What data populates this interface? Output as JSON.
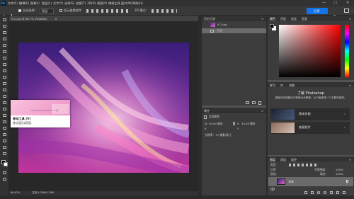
{
  "app": {
    "logo": "Ps",
    "menus": [
      "文件(F)",
      "编辑(E)",
      "图像(I)",
      "图层(L)",
      "文字(Y)",
      "选择(S)",
      "滤镜(T)",
      "3D(D)",
      "视图(V)",
      "增效工具",
      "窗口(W)",
      "帮助(H)"
    ],
    "window_controls": [
      "—",
      "□",
      "✕"
    ]
  },
  "options_bar": {
    "auto_select_label": "自动选择：",
    "auto_select_value": "图层",
    "transform_label": "显示变换控件",
    "mode_3d_label": "3D 模式：",
    "share_button": "分享"
  },
  "document": {
    "tab_title": "9-1.jpg @ 66.7% (RGB/8#)",
    "zoom": "66.67%",
    "doc_info": "文档:4.29M/4.29M"
  },
  "tooltip": {
    "title": "移动工具 (V)",
    "description": "移动选区或图层"
  },
  "history_panel": {
    "tabs": [
      "历史记录"
    ],
    "snapshot_name": "9-1.jpg",
    "items": [
      "打开"
    ]
  },
  "properties_panel": {
    "tab": "属性",
    "section": "文档属性",
    "w_label": "W",
    "w_value": "40.64 厘米",
    "h_label": "H",
    "h_value": "30.48 厘米",
    "x_label": "X",
    "y_label": "Y",
    "resolution": "分辨率：72 像素/英寸"
  },
  "color_panel": {
    "tabs": [
      "颜色",
      "色板",
      "渐变",
      "图案"
    ],
    "foreground": "#000000",
    "background": "#ffffff"
  },
  "learn_panel": {
    "tabs": [
      "学习",
      "库",
      "调整"
    ],
    "title": "了解 Photoshop",
    "subtitle": "直接在应用程序中获取分步教程。从下面选择一个主题开始吧。",
    "cards": [
      "基本技能",
      "修复照片"
    ]
  },
  "layers_panel": {
    "tabs": [
      "图层",
      "通道",
      "路径"
    ],
    "filter_label": "类型",
    "blend_mode": "正常",
    "opacity_label": "不透明度：",
    "opacity_value": "100%",
    "lock_label": "锁定：",
    "fill_label": "填充：",
    "fill_value": "100%",
    "layers": [
      {
        "name": "背景",
        "selected": true
      }
    ]
  }
}
